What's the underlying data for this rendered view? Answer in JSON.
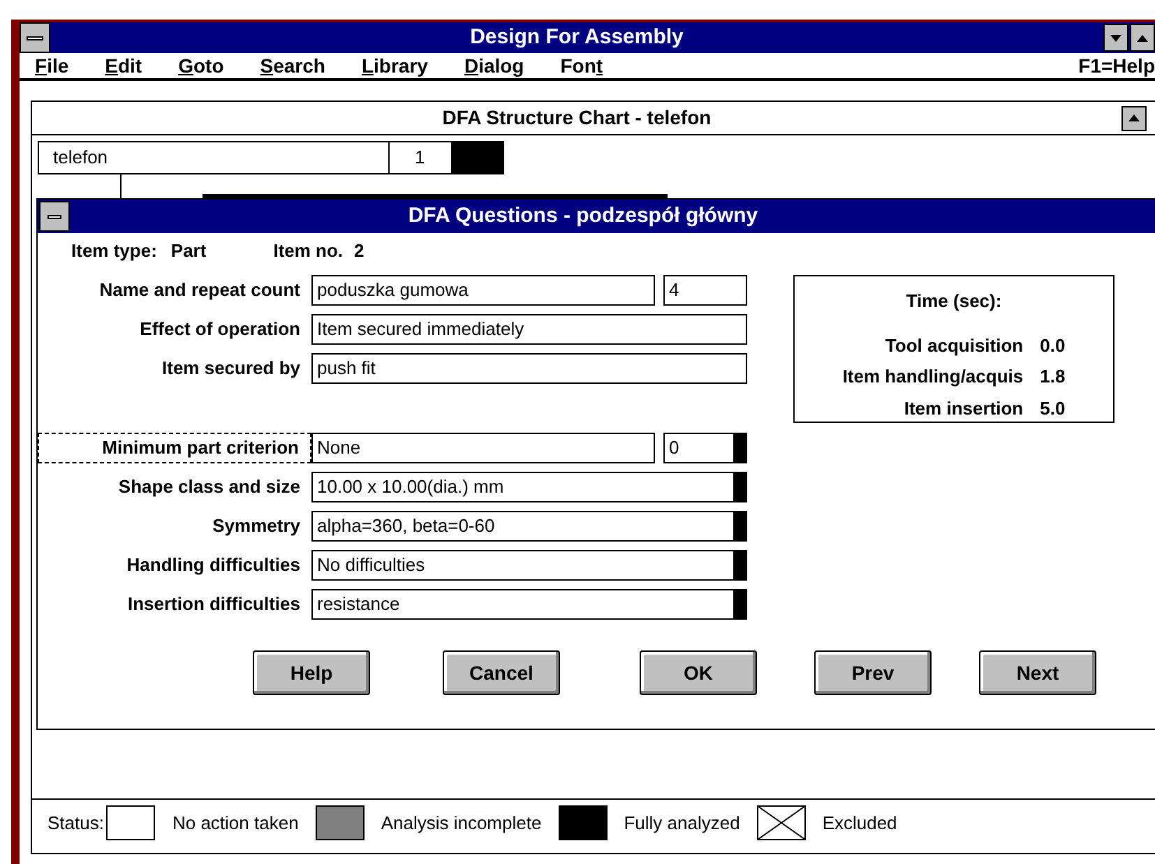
{
  "window": {
    "title": "Design For Assembly"
  },
  "menu": [
    {
      "underlined": "F",
      "after": "ile"
    },
    {
      "underlined": "E",
      "after": "dit"
    },
    {
      "underlined": "G",
      "after": "oto"
    },
    {
      "underlined": "S",
      "after": "earch"
    },
    {
      "underlined": "L",
      "after": "ibrary"
    },
    {
      "underlined": "D",
      "after": "ialog"
    },
    {
      "before": "Fon",
      "underlined": "t"
    }
  ],
  "help_hint": "F1=Help",
  "structure_chart": {
    "title": "DFA Structure Chart - telefon",
    "node": {
      "name": "telefon",
      "count": "1",
      "analyzed": true
    }
  },
  "dialog": {
    "title": "DFA Questions - podzespół główny",
    "item_type_label": "Item type:",
    "item_type": "Part",
    "item_no_label": "Item no.",
    "item_no": "2",
    "operation_rows": [
      {
        "label": "Name and repeat count",
        "focused": false,
        "fields": [
          {
            "value": "poduszka gumowa",
            "analyzed": false
          },
          {
            "value": "4",
            "analyzed": false
          }
        ]
      },
      {
        "label": "Effect of operation",
        "focused": false,
        "fields": [
          {
            "value": "Item secured immediately",
            "analyzed": false
          }
        ]
      },
      {
        "label": "Item secured by",
        "focused": false,
        "fields": [
          {
            "value": "push fit",
            "analyzed": false
          }
        ]
      }
    ],
    "attribute_rows": [
      {
        "label": "Minimum part criterion",
        "focused": true,
        "fields": [
          {
            "value": "None",
            "analyzed": false
          },
          {
            "value": "0",
            "analyzed": true
          }
        ]
      },
      {
        "label": "Shape class and size",
        "focused": false,
        "fields": [
          {
            "value": "10.00 x 10.00(dia.) mm",
            "analyzed": true
          }
        ]
      },
      {
        "label": "Symmetry",
        "focused": false,
        "fields": [
          {
            "value": "alpha=360, beta=0-60",
            "analyzed": true
          }
        ]
      },
      {
        "label": "Handling difficulties",
        "focused": false,
        "fields": [
          {
            "value": "No difficulties",
            "analyzed": true
          }
        ]
      },
      {
        "label": "Insertion difficulties",
        "focused": false,
        "fields": [
          {
            "value": "resistance",
            "analyzed": true
          }
        ]
      }
    ],
    "time": {
      "title": "Time (sec):",
      "items": [
        {
          "label": "Tool acquisition",
          "value": "0.0"
        },
        {
          "label": "Item handling/acquis",
          "value": "1.8"
        },
        {
          "label": "Item insertion",
          "value": "5.0"
        }
      ]
    },
    "buttons": [
      "Help",
      "Cancel",
      "OK",
      "Prev",
      "Next"
    ]
  },
  "status_bar": {
    "label": "Status:",
    "legend": [
      {
        "kind": "none",
        "label": "No action taken"
      },
      {
        "kind": "incomplete",
        "label": "Analysis incomplete"
      },
      {
        "kind": "complete",
        "label": "Fully analyzed"
      },
      {
        "kind": "excluded",
        "label": "Excluded"
      }
    ]
  }
}
